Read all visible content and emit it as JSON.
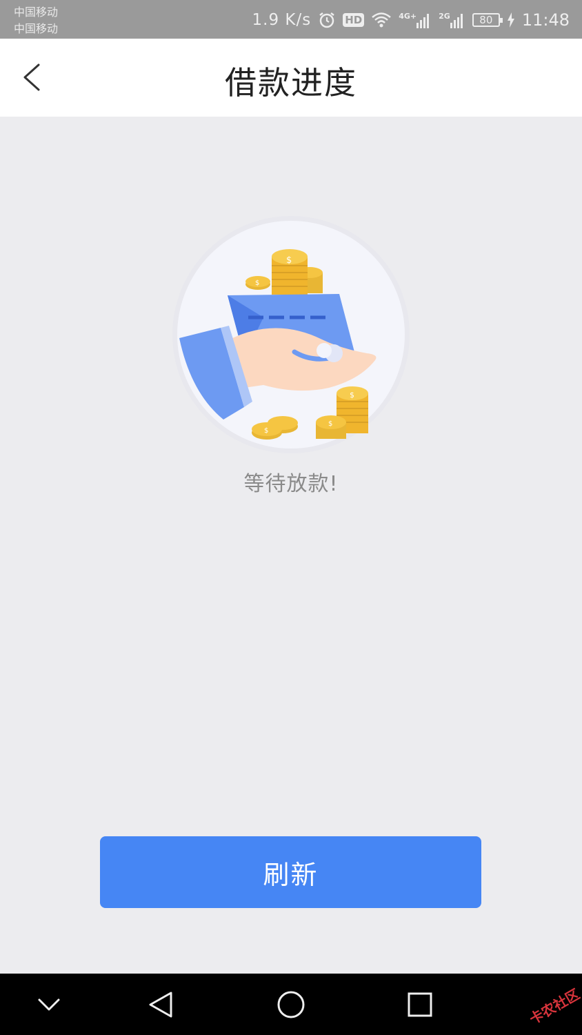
{
  "status_bar": {
    "carrier_1": "中国移动",
    "carrier_2": "中国移动",
    "net_speed": "1.9 K/s",
    "hd_label": "HD",
    "signal_1_label": "4G+",
    "signal_2_label": "2G",
    "battery_level": "80",
    "time": "11:48",
    "icons": [
      "alarm-icon",
      "hd-icon",
      "wifi-icon",
      "signal-icon",
      "signal-icon",
      "battery-icon",
      "charging-icon"
    ]
  },
  "header": {
    "title": "借款进度",
    "back_icon": "chevron-left-icon"
  },
  "main": {
    "illustration": "hand-holding-card-with-coins",
    "status_text": "等待放款!",
    "refresh_label": "刷新"
  },
  "nav_bar": {
    "icons": [
      "chevron-down-icon",
      "back-triangle-icon",
      "home-circle-icon",
      "recents-square-icon"
    ]
  },
  "watermark": "卡农社区",
  "colors": {
    "primary_button": "#4686f4",
    "background": "#ececef",
    "status_bar": "#9a9a9a",
    "coin": "#f5c542",
    "card": "#5b8df0"
  }
}
